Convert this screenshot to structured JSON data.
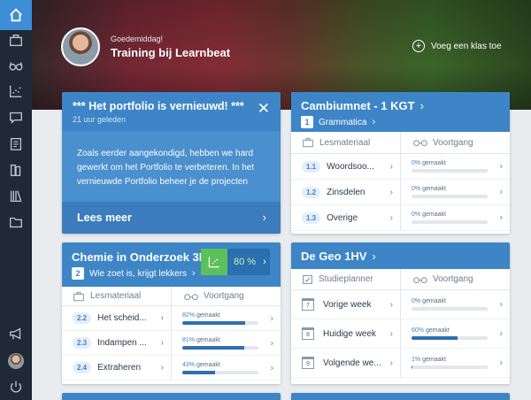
{
  "sidebar": {
    "items": [
      {
        "icon": "home-icon"
      },
      {
        "icon": "briefcase-icon"
      },
      {
        "icon": "glasses-icon"
      },
      {
        "icon": "scatter-chart-icon"
      },
      {
        "icon": "chat-icon"
      },
      {
        "icon": "clipboard-icon"
      },
      {
        "icon": "books-icon"
      },
      {
        "icon": "library-icon"
      },
      {
        "icon": "folder-icon"
      }
    ],
    "bottom": [
      {
        "icon": "megaphone-icon"
      },
      {
        "icon": "user-avatar"
      },
      {
        "icon": "power-icon"
      }
    ]
  },
  "hero": {
    "greeting": "Goedemiddag!",
    "title": "Training bij Learnbeat",
    "add_class_label": "Voeg een klas toe"
  },
  "announcement": {
    "title": "*** Het portfolio is vernieuwd! ***",
    "time": "21 uur geleden",
    "body": "Zoals eerder aangekondigd, hebben we hard gewerkt om het Portfolio te verbeteren. In het vernieuwde Portfolio beheer je de projecten",
    "read_more": "Lees meer"
  },
  "chemie": {
    "title": "Chemie in Onderzoek 3H",
    "sub_num": "2",
    "sub_label": "Wie zoet is, krijgt lekkers",
    "score": "80 %",
    "score_fraction": 0.8,
    "col1": "Lesmateriaal",
    "col2": "Voortgang",
    "rows": [
      {
        "num": "2.2",
        "label": "Het scheid...",
        "pct": "82%",
        "suffix": "gemaakt",
        "value": 0.82
      },
      {
        "num": "2.3",
        "label": "Indampen ...",
        "pct": "81%",
        "suffix": "gemaakt",
        "value": 0.81
      },
      {
        "num": "2.4",
        "label": "Extraheren",
        "pct": "43%",
        "suffix": "gemaakt",
        "value": 0.43
      }
    ]
  },
  "cambiumnet": {
    "title": "Cambiumnet - 1 KGT",
    "sub_num": "1",
    "sub_label": "Grammatica",
    "col1": "Lesmateriaal",
    "col2": "Voortgang",
    "rows": [
      {
        "num": "1.1",
        "label": "Woordsoo...",
        "pct": "0%",
        "suffix": "gemaakt",
        "value": 0
      },
      {
        "num": "1.2",
        "label": "Zinsdelen",
        "pct": "0%",
        "suffix": "gemaakt",
        "value": 0
      },
      {
        "num": "1.3",
        "label": "Overige",
        "pct": "0%",
        "suffix": "gemaakt",
        "value": 0
      }
    ]
  },
  "geo": {
    "title": "De Geo 1HV",
    "col1": "Studieplanner",
    "col2": "Voortgang",
    "rows": [
      {
        "num": "7",
        "label": "Vorige week",
        "pct": "0%",
        "suffix": "gemaakt",
        "value": 0
      },
      {
        "num": "8",
        "label": "Huidige week",
        "pct": "60%",
        "suffix": "gemaakt",
        "value": 0.6
      },
      {
        "num": "9",
        "label": "Volgende we...",
        "pct": "1%",
        "suffix": "gemaakt",
        "value": 0.01
      }
    ]
  }
}
